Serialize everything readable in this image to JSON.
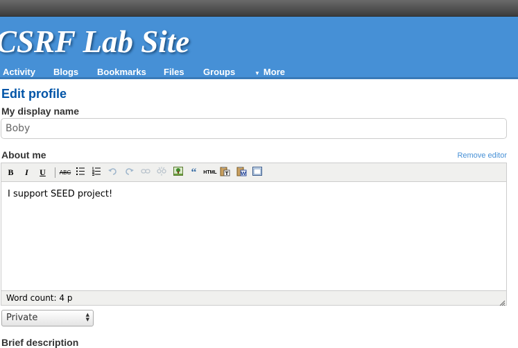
{
  "site": {
    "title": "CSRF Lab Site"
  },
  "nav": {
    "items": [
      {
        "label": "Activity"
      },
      {
        "label": "Blogs"
      },
      {
        "label": "Bookmarks"
      },
      {
        "label": "Files"
      },
      {
        "label": "Groups"
      }
    ],
    "more_label": "More",
    "more_caret": "▼"
  },
  "page": {
    "heading": "Edit profile"
  },
  "form": {
    "display_name": {
      "label": "My display name",
      "value": "Boby"
    },
    "about_me": {
      "label": "About me",
      "remove_editor": "Remove editor",
      "content": "I support SEED project!",
      "word_count": "Word count: 4 p"
    },
    "access": {
      "selected": "Private"
    },
    "brief_description": {
      "label": "Brief description"
    }
  },
  "toolbar": {
    "bold": "B",
    "italic": "I",
    "underline": "U",
    "strikethrough": "ABC",
    "blockquote": "“",
    "html": "HTML"
  },
  "colors": {
    "header": "#4690d6",
    "link": "#4690d6",
    "heading": "#0054a7"
  }
}
